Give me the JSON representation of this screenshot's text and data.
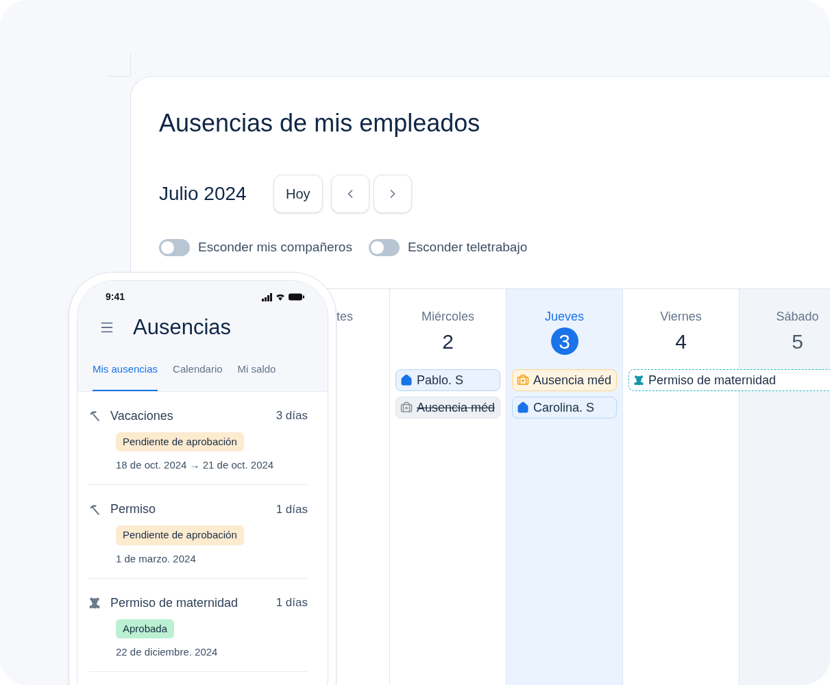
{
  "page": {
    "title": "Ausencias de mis empleados"
  },
  "calendar": {
    "month": "Julio 2024",
    "today_button": "Hoy",
    "toggles": [
      {
        "label": "Esconder mis compañeros",
        "on": false
      },
      {
        "label": "Esconder teletrabajo",
        "on": false
      }
    ],
    "days": [
      {
        "name": "tes",
        "today": false,
        "weekend": false
      },
      {
        "name": "Miércoles",
        "number": "2",
        "today": false,
        "weekend": false,
        "events": [
          {
            "kind": "remote",
            "label": "Pablo. S",
            "cancelled": false
          },
          {
            "kind": "medical",
            "label": "Ausencia méd",
            "cancelled": true
          }
        ]
      },
      {
        "name": "Jueves",
        "number": "3",
        "today": true,
        "weekend": false,
        "events": [
          {
            "kind": "medical",
            "label": "Ausencia méd",
            "cancelled": false
          },
          {
            "kind": "remote",
            "label": "Carolina. S",
            "cancelled": false
          }
        ]
      },
      {
        "name": "Viernes",
        "number": "4",
        "today": false,
        "weekend": false,
        "events": [
          {
            "kind": "maternity",
            "label": "Permiso de maternidad",
            "cancelled": false
          }
        ]
      },
      {
        "name": "Sábado",
        "number": "5",
        "today": false,
        "weekend": true
      }
    ]
  },
  "phone": {
    "status_bar": {
      "time": "9:41"
    },
    "title": "Ausencias",
    "tabs": [
      {
        "label": "Mis ausencias",
        "selected": true
      },
      {
        "label": "Calendario",
        "selected": false
      },
      {
        "label": "Mi saldo",
        "selected": false
      }
    ],
    "requests": [
      {
        "kind": "beach",
        "type": "Vacaciones",
        "duration": "3 días",
        "status": {
          "kind": "pending",
          "label": "Pendiente de aprobación"
        },
        "dates": "18 de oct. 2024 → 21 de oct. 2024"
      },
      {
        "kind": "beach",
        "type": "Permiso",
        "duration": "1 días",
        "status": {
          "kind": "pending",
          "label": "Pendiente de aprobación"
        },
        "dates": "1 de marzo. 2024"
      },
      {
        "kind": "baby",
        "type": "Permiso de maternidad",
        "duration": "1 días",
        "status": {
          "kind": "approved",
          "label": "Aprobada"
        },
        "dates": "22 de diciembre. 2024"
      }
    ]
  }
}
